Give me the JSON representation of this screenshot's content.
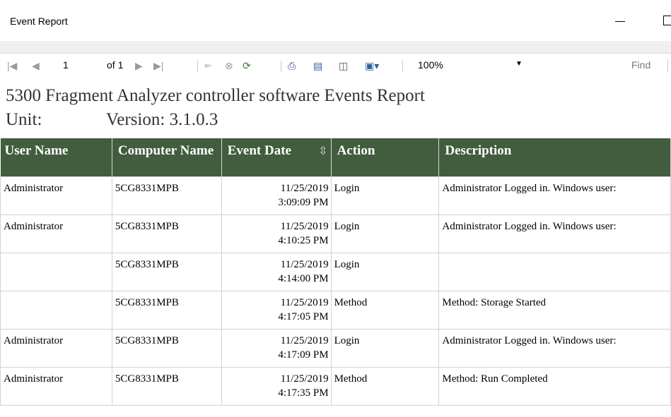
{
  "window": {
    "title": "Event Report"
  },
  "toolbar": {
    "page_current": "1",
    "page_of": "of 1",
    "zoom": "100%",
    "find_label": "Find",
    "find_value": ""
  },
  "report": {
    "title": "5300 Fragment Analyzer controller software Events Report",
    "unit_label": "Unit:",
    "version_label": "Version: 3.1.0.3",
    "header_color": "#425c3e",
    "columns": {
      "user_name": "User Name",
      "computer_name": "Computer Name",
      "event_date": "Event Date",
      "action": "Action",
      "description": "Description"
    },
    "rows": [
      {
        "user": "Administrator",
        "computer": "5CG8331MPB",
        "date": "11/25/2019",
        "time": "3:09:09 PM",
        "action": "Login",
        "description": "Administrator Logged in. Windows user:"
      },
      {
        "user": "Administrator",
        "computer": "5CG8331MPB",
        "date": "11/25/2019",
        "time": "4:10:25 PM",
        "action": "Login",
        "description": "Administrator Logged in. Windows user:"
      },
      {
        "user": "",
        "computer": "5CG8331MPB",
        "date": "11/25/2019",
        "time": "4:14:00 PM",
        "action": "Login",
        "description": ""
      },
      {
        "user": "",
        "computer": "5CG8331MPB",
        "date": "11/25/2019",
        "time": "4:17:05 PM",
        "action": "Method",
        "description": "Method: Storage Started"
      },
      {
        "user": "Administrator",
        "computer": "5CG8331MPB",
        "date": "11/25/2019",
        "time": "4:17:09 PM",
        "action": "Login",
        "description": "Administrator Logged in. Windows user:"
      },
      {
        "user": "Administrator",
        "computer": "5CG8331MPB",
        "date": "11/25/2019",
        "time": "4:17:35 PM",
        "action": "Method",
        "description": "Method: Run Completed"
      }
    ]
  }
}
